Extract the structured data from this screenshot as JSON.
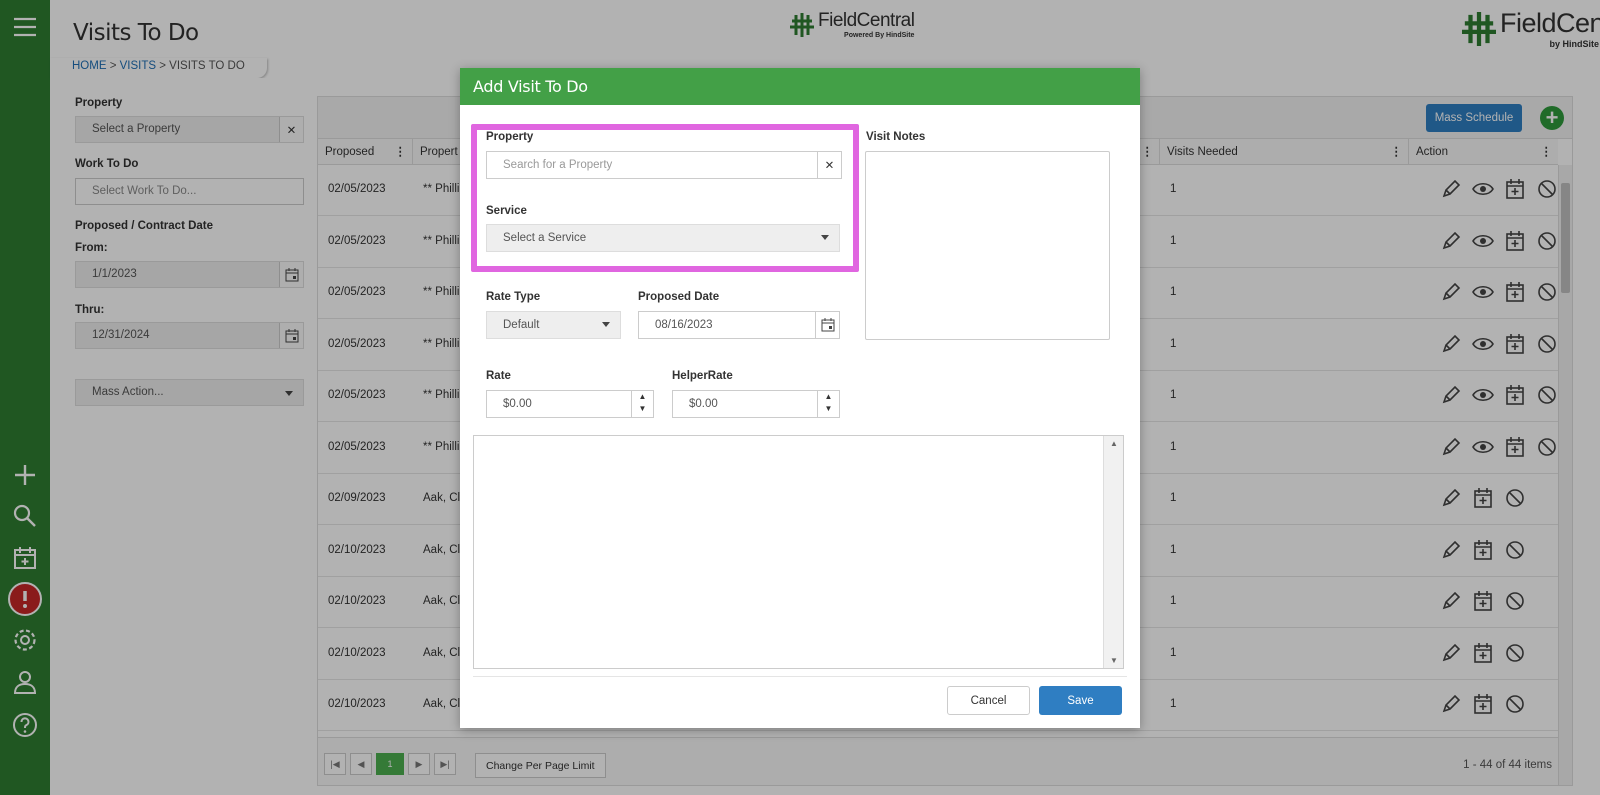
{
  "page": {
    "title": "Visits To Do",
    "breadcrumb": {
      "home": "HOME",
      "sep1": " > ",
      "visits": "VISITS",
      "sep2": " > ",
      "current": "VISITS TO DO"
    }
  },
  "logos": {
    "center_name": "FieldCentral",
    "center_sub": "Powered By HindSite",
    "right_name": "FieldCentral",
    "right_sub": "by HindSite Software"
  },
  "filters": {
    "property_label": "Property",
    "property_placeholder": "Select a Property",
    "work_label": "Work To Do",
    "work_placeholder": "Select Work To Do...",
    "date_label": "Proposed / Contract Date",
    "from_label": "From:",
    "from_value": "1/1/2023",
    "thru_label": "Thru:",
    "thru_value": "12/31/2024",
    "mass_action": "Mass Action..."
  },
  "grid": {
    "mass_schedule": "Mass Schedule",
    "columns": {
      "proposed": "Proposed",
      "property": "Propert",
      "visits_needed": "Visits Needed",
      "action": "Action"
    },
    "rows": [
      {
        "proposed": "02/05/2023",
        "property": "** Philli",
        "visits": "1",
        "view": true
      },
      {
        "proposed": "02/05/2023",
        "property": "** Philli",
        "visits": "1",
        "view": true
      },
      {
        "proposed": "02/05/2023",
        "property": "** Philli",
        "visits": "1",
        "view": true
      },
      {
        "proposed": "02/05/2023",
        "property": "** Philli",
        "visits": "1",
        "view": true
      },
      {
        "proposed": "02/05/2023",
        "property": "** Philli",
        "visits": "1",
        "view": true
      },
      {
        "proposed": "02/05/2023",
        "property": "** Philli",
        "visits": "1",
        "view": true
      },
      {
        "proposed": "02/09/2023",
        "property": "Aak, Cl",
        "visits": "1",
        "view": false
      },
      {
        "proposed": "02/10/2023",
        "property": "Aak, Cl",
        "visits": "1",
        "view": false
      },
      {
        "proposed": "02/10/2023",
        "property": "Aak, Cl",
        "visits": "1",
        "view": false
      },
      {
        "proposed": "02/10/2023",
        "property": "Aak, Cl",
        "visits": "1",
        "view": false
      },
      {
        "proposed": "02/10/2023",
        "property": "Aak, Cl",
        "visits": "1",
        "view": false
      }
    ],
    "pager": {
      "current_page": "1",
      "change_per_page": "Change Per Page Limit",
      "items": "1 - 44 of 44 items"
    }
  },
  "modal": {
    "title": "Add Visit To Do",
    "property_label": "Property",
    "property_placeholder": "Search for a Property",
    "service_label": "Service",
    "service_placeholder": "Select a Service",
    "visit_notes_label": "Visit Notes",
    "rate_type_label": "Rate Type",
    "rate_type_value": "Default",
    "proposed_date_label": "Proposed Date",
    "proposed_date_value": "08/16/2023",
    "rate_label": "Rate",
    "rate_value": "$0.00",
    "helper_rate_label": "HelperRate",
    "helper_rate_value": "$0.00",
    "cancel": "Cancel",
    "save": "Save"
  },
  "colors": {
    "nav_green": "#2e7d32",
    "modal_header_green": "#43a047",
    "primary_blue": "#2f7ec2",
    "highlight_magenta": "#e066e0",
    "alert_red": "#c62828"
  }
}
